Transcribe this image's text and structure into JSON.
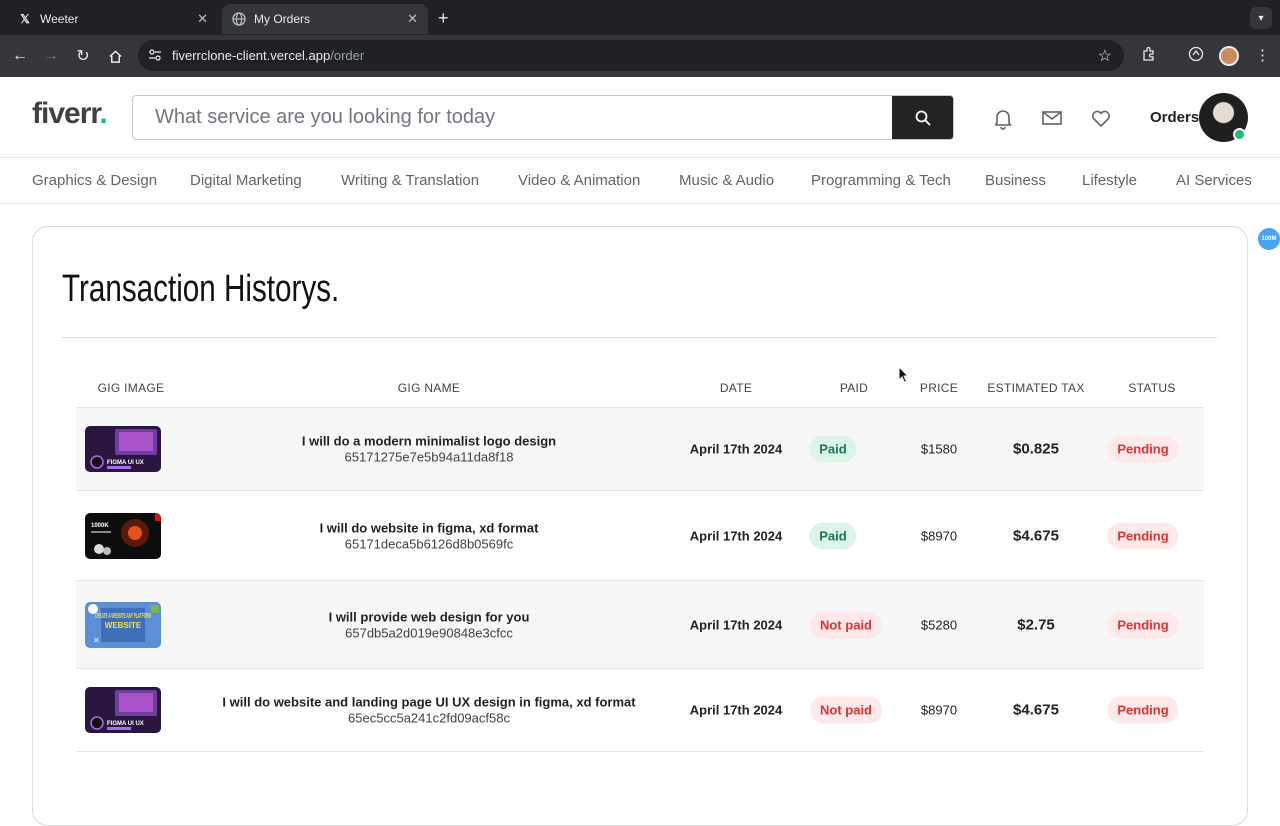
{
  "browser": {
    "tabs": [
      {
        "title": "Weeter",
        "icon": "x-logo-icon"
      },
      {
        "title": "My Orders",
        "icon": "globe-icon"
      }
    ],
    "url_host": "fiverrclone-client.vercel.app",
    "url_path": "/order"
  },
  "header": {
    "logo_text": "fiverr",
    "logo_dot": ".",
    "search_placeholder": "What service are you looking for today",
    "orders_label": "Orders"
  },
  "categories": [
    "Graphics & Design",
    "Digital Marketing",
    "Writing & Translation",
    "Video & Animation",
    "Music & Audio",
    "Programming & Tech",
    "Business",
    "Lifestyle",
    "AI Services"
  ],
  "page": {
    "title": "Transaction Historys."
  },
  "table": {
    "headers": [
      "GIG IMAGE",
      "GIG NAME",
      "DATE",
      "PAID",
      "PRICE",
      "ESTIMATED TAX",
      "STATUS"
    ],
    "rows": [
      {
        "name": "I will do a modern minimalist logo design",
        "id": "65171275e7e5b94a11da8f18",
        "date": "April 17th 2024",
        "paid": "Paid",
        "price": "$1580",
        "tax": "$0.825",
        "status": "Pending",
        "thumb": "figma-ui-ux"
      },
      {
        "name": "I will do website in figma, xd format",
        "id": "65171deca5b6126d8b0569fc",
        "date": "April 17th 2024",
        "paid": "Paid",
        "price": "$8970",
        "tax": "$4.675",
        "status": "Pending",
        "thumb": "dark-website"
      },
      {
        "name": "I will provide web design for you",
        "id": "657db5a2d019e90848e3cfcc",
        "date": "April 17th 2024",
        "paid": "Not paid",
        "price": "$5280",
        "tax": "$2.75",
        "status": "Pending",
        "thumb": "create-website"
      },
      {
        "name": "I will do website and landing page UI UX design in figma, xd format",
        "id": "65ec5cc5a241c2fd09acf58c",
        "date": "April 17th 2024",
        "paid": "Not paid",
        "price": "$8970",
        "tax": "$4.675",
        "status": "Pending",
        "thumb": "figma-ui-ux"
      }
    ]
  },
  "thumb_texts": {
    "figma": "FIGMA UI UX",
    "create": "CREATE A WEBSITE ANY PLATFORM",
    "dark": "1000K"
  },
  "side_badge": "100M",
  "colors": {
    "brand_green": "#1dbf73",
    "paid_bg": "#dcf4ea",
    "unpaid_bg": "#fde9e9",
    "status_red": "#dd3333"
  }
}
